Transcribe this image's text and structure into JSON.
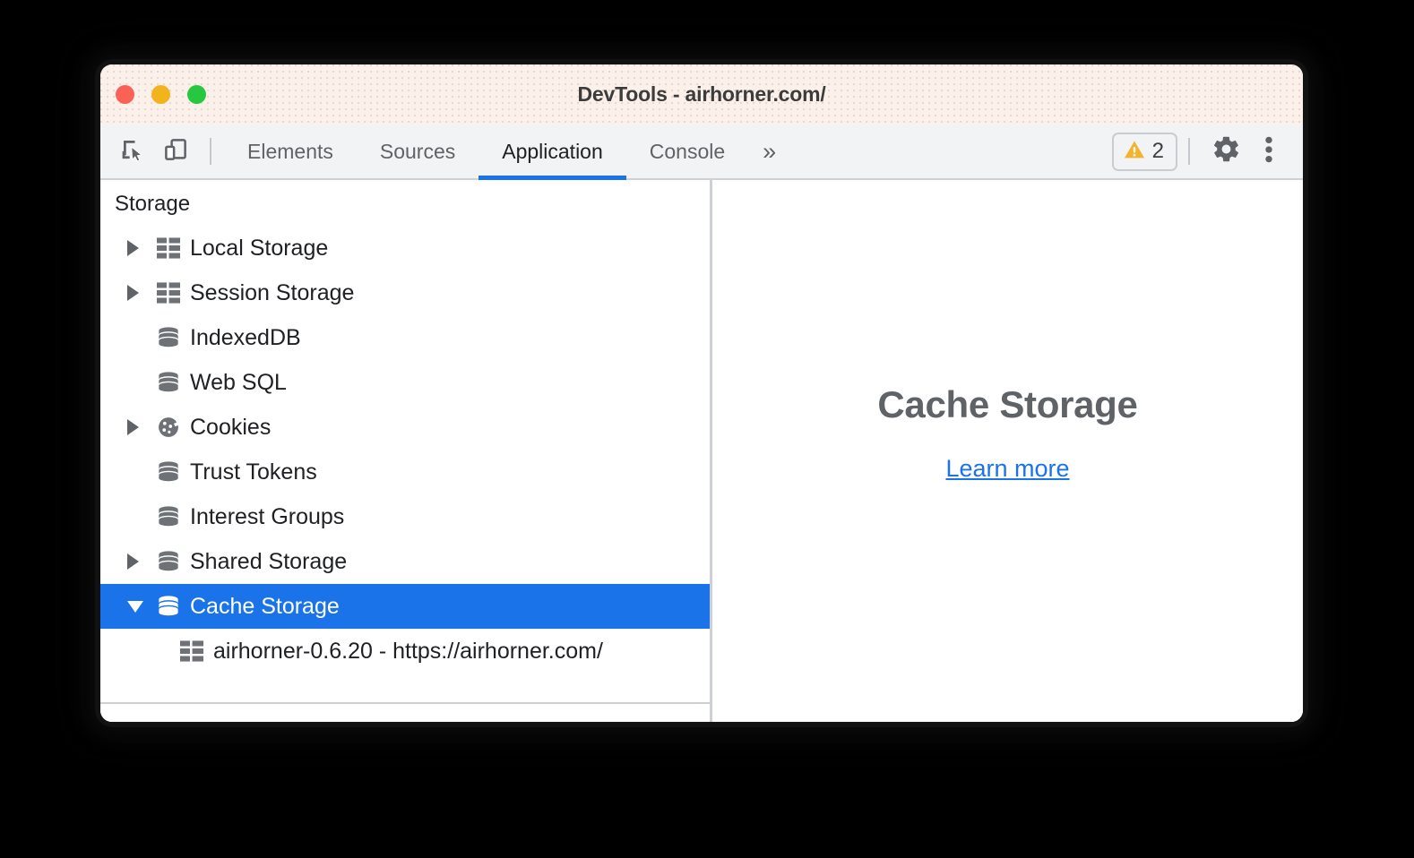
{
  "window": {
    "title": "DevTools - airhorner.com/",
    "traffic_lights": [
      {
        "name": "close",
        "color": "#fc6157"
      },
      {
        "name": "minimize",
        "color": "#f2b41c"
      },
      {
        "name": "zoom",
        "color": "#27c83f"
      }
    ]
  },
  "toolbar": {
    "icons": [
      {
        "name": "inspect-element-icon"
      },
      {
        "name": "device-toolbar-icon"
      }
    ],
    "tabs": [
      {
        "label": "Elements",
        "active": false
      },
      {
        "label": "Sources",
        "active": false
      },
      {
        "label": "Application",
        "active": true
      },
      {
        "label": "Console",
        "active": false
      }
    ],
    "overflow_label": "»",
    "warning_count": "2",
    "warning_icon": "warning-triangle-icon",
    "settings_icon": "gear-icon",
    "more_icon": "three-dots-icon",
    "accent_color": "#1a73e8"
  },
  "sidebar": {
    "header": "Storage",
    "items": [
      {
        "label": "Local Storage",
        "icon": "table-icon",
        "twisty": "collapsed",
        "indent": 0
      },
      {
        "label": "Session Storage",
        "icon": "table-icon",
        "twisty": "collapsed",
        "indent": 0
      },
      {
        "label": "IndexedDB",
        "icon": "database-icon",
        "twisty": "none",
        "indent": 0
      },
      {
        "label": "Web SQL",
        "icon": "database-icon",
        "twisty": "none",
        "indent": 0
      },
      {
        "label": "Cookies",
        "icon": "cookie-icon",
        "twisty": "collapsed",
        "indent": 0
      },
      {
        "label": "Trust Tokens",
        "icon": "database-icon",
        "twisty": "none",
        "indent": 0
      },
      {
        "label": "Interest Groups",
        "icon": "database-icon",
        "twisty": "none",
        "indent": 0
      },
      {
        "label": "Shared Storage",
        "icon": "database-icon",
        "twisty": "collapsed",
        "indent": 0
      },
      {
        "label": "Cache Storage",
        "icon": "database-icon",
        "twisty": "expanded",
        "indent": 0,
        "selected": true
      },
      {
        "label": "airhorner-0.6.20 - https://airhorner.com/",
        "icon": "table-icon",
        "twisty": "none",
        "indent": 1
      }
    ],
    "selected_background": "#1a73e8"
  },
  "main": {
    "title": "Cache Storage",
    "link": "Learn more",
    "link_color": "#1a73e8"
  }
}
